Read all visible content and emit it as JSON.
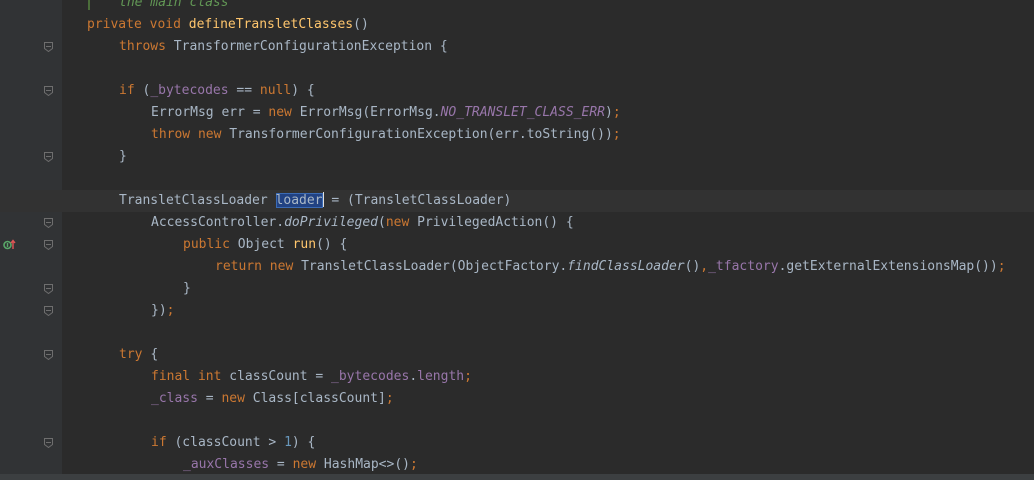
{
  "editor": {
    "lines": [
      {
        "id": "l0",
        "indent": 1,
        "fold": false,
        "segments": [
          {
            "t": "the main class",
            "c": "cmt"
          }
        ]
      },
      {
        "id": "l1",
        "indent": 0,
        "fold": false,
        "segments": [
          {
            "t": "private ",
            "c": "kw"
          },
          {
            "t": "void ",
            "c": "kw"
          },
          {
            "t": "defineTransletClasses",
            "c": "fn"
          },
          {
            "t": "()",
            "c": ""
          }
        ]
      },
      {
        "id": "l2",
        "indent": 1,
        "fold": true,
        "segments": [
          {
            "t": "throws ",
            "c": "kw"
          },
          {
            "t": "TransformerConfigurationException {",
            "c": ""
          }
        ]
      },
      {
        "id": "l3",
        "indent": 0,
        "fold": false,
        "segments": []
      },
      {
        "id": "l4",
        "indent": 1,
        "fold": true,
        "segments": [
          {
            "t": "if ",
            "c": "kw"
          },
          {
            "t": "(",
            "c": ""
          },
          {
            "t": "_bytecodes",
            "c": "fld"
          },
          {
            "t": " == ",
            "c": ""
          },
          {
            "t": "null",
            "c": "kw"
          },
          {
            "t": ") {",
            "c": ""
          }
        ]
      },
      {
        "id": "l5",
        "indent": 2,
        "fold": false,
        "segments": [
          {
            "t": "ErrorMsg err = ",
            "c": ""
          },
          {
            "t": "new ",
            "c": "kw"
          },
          {
            "t": "ErrorMsg(ErrorMsg.",
            "c": ""
          },
          {
            "t": "NO_TRANSLET_CLASS_ERR",
            "c": "itf"
          },
          {
            "t": ")",
            "c": ""
          },
          {
            "t": ";",
            "c": "kw"
          }
        ]
      },
      {
        "id": "l6",
        "indent": 2,
        "fold": false,
        "segments": [
          {
            "t": "throw ",
            "c": "kw"
          },
          {
            "t": "new ",
            "c": "kw"
          },
          {
            "t": "TransformerConfigurationException(err.toString())",
            "c": ""
          },
          {
            "t": ";",
            "c": "kw"
          }
        ]
      },
      {
        "id": "l7",
        "indent": 1,
        "fold": true,
        "segments": [
          {
            "t": "}",
            "c": ""
          }
        ]
      },
      {
        "id": "l8",
        "indent": 0,
        "fold": false,
        "segments": []
      },
      {
        "id": "l9",
        "indent": 1,
        "fold": false,
        "current": true,
        "segments": [
          {
            "t": "TransletClassLoader ",
            "c": ""
          },
          {
            "t": "loader",
            "c": "sel"
          },
          {
            "t": "",
            "c": "caret"
          },
          {
            "t": " = (TransletClassLoader)",
            "c": ""
          }
        ]
      },
      {
        "id": "l10",
        "indent": 2,
        "fold": true,
        "segments": [
          {
            "t": "AccessController.",
            "c": ""
          },
          {
            "t": "doPrivileged",
            "c": "it"
          },
          {
            "t": "(",
            "c": ""
          },
          {
            "t": "new ",
            "c": "kw"
          },
          {
            "t": "PrivilegedAction() {",
            "c": ""
          }
        ]
      },
      {
        "id": "l11",
        "indent": 3,
        "fold": true,
        "gutter_icon": "override-marker",
        "segments": [
          {
            "t": "public ",
            "c": "kw"
          },
          {
            "t": "Object ",
            "c": ""
          },
          {
            "t": "run",
            "c": "fn"
          },
          {
            "t": "() {",
            "c": ""
          }
        ]
      },
      {
        "id": "l12",
        "indent": 4,
        "fold": false,
        "segments": [
          {
            "t": "return ",
            "c": "kw"
          },
          {
            "t": "new ",
            "c": "kw"
          },
          {
            "t": "TransletClassLoader(ObjectFactory.",
            "c": ""
          },
          {
            "t": "findClassLoader",
            "c": "it"
          },
          {
            "t": "()",
            "c": ""
          },
          {
            "t": ",",
            "c": "kw"
          },
          {
            "t": "_tfactory",
            "c": "fld"
          },
          {
            "t": ".getExternalExtensionsMap())",
            "c": ""
          },
          {
            "t": ";",
            "c": "kw"
          }
        ]
      },
      {
        "id": "l13",
        "indent": 3,
        "fold": true,
        "segments": [
          {
            "t": "}",
            "c": ""
          }
        ]
      },
      {
        "id": "l14",
        "indent": 2,
        "fold": true,
        "segments": [
          {
            "t": "})",
            "c": ""
          },
          {
            "t": ";",
            "c": "kw"
          }
        ]
      },
      {
        "id": "l15",
        "indent": 0,
        "fold": false,
        "segments": []
      },
      {
        "id": "l16",
        "indent": 1,
        "fold": true,
        "segments": [
          {
            "t": "try ",
            "c": "kw"
          },
          {
            "t": "{",
            "c": ""
          }
        ]
      },
      {
        "id": "l17",
        "indent": 2,
        "fold": false,
        "segments": [
          {
            "t": "final ",
            "c": "kw"
          },
          {
            "t": "int ",
            "c": "kw"
          },
          {
            "t": "classCount = ",
            "c": ""
          },
          {
            "t": "_bytecodes",
            "c": "fld"
          },
          {
            "t": ".",
            "c": ""
          },
          {
            "t": "length",
            "c": "fld"
          },
          {
            "t": ";",
            "c": "kw"
          }
        ]
      },
      {
        "id": "l18",
        "indent": 2,
        "fold": false,
        "segments": [
          {
            "t": "_class",
            "c": "fld"
          },
          {
            "t": " = ",
            "c": ""
          },
          {
            "t": "new ",
            "c": "kw"
          },
          {
            "t": "Class[classCount]",
            "c": ""
          },
          {
            "t": ";",
            "c": "kw"
          }
        ]
      },
      {
        "id": "l19",
        "indent": 0,
        "fold": false,
        "segments": []
      },
      {
        "id": "l20",
        "indent": 2,
        "fold": true,
        "segments": [
          {
            "t": "if ",
            "c": "kw"
          },
          {
            "t": "(classCount > ",
            "c": ""
          },
          {
            "t": "1",
            "c": "num"
          },
          {
            "t": ") {",
            "c": ""
          }
        ]
      },
      {
        "id": "l21",
        "indent": 3,
        "fold": false,
        "segments": [
          {
            "t": "_auxClasses",
            "c": "fld"
          },
          {
            "t": " = ",
            "c": ""
          },
          {
            "t": "new ",
            "c": "kw"
          },
          {
            "t": "HashMap<>()",
            "c": ""
          },
          {
            "t": ";",
            "c": "kw"
          }
        ]
      }
    ]
  },
  "colors": {
    "background": "#2b2b2b",
    "keyword": "#cc7832",
    "method_decl": "#ffc66d",
    "field": "#9876aa",
    "number": "#6897bb",
    "doc_comment": "#629755",
    "selection": "#214283"
  }
}
